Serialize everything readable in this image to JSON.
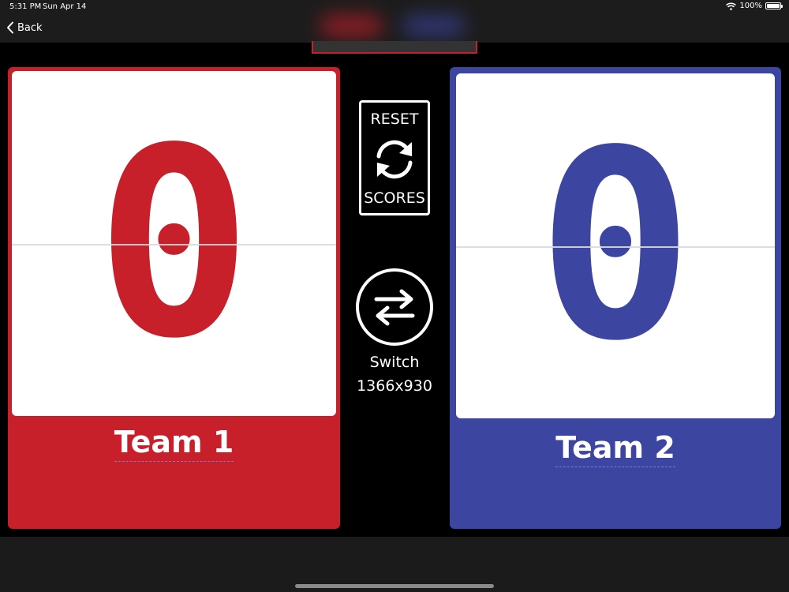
{
  "status_bar": {
    "time": "5:31 PM",
    "date": "Sun Apr 14",
    "battery": "100%"
  },
  "nav": {
    "back_label": "Back"
  },
  "center": {
    "reset_top": "RESET",
    "reset_bottom": "SCORES",
    "switch_label": "Switch",
    "size_label": "1366x930"
  },
  "teams": [
    {
      "name": "Team 1",
      "score": "0",
      "color": "#c8202a"
    },
    {
      "name": "Team 2",
      "score": "0",
      "color": "#3c45a0"
    }
  ],
  "colors": {
    "background": "#000000",
    "topbar": "#1c1c1c",
    "red": "#c8202a",
    "blue": "#3c45a0"
  },
  "icons": [
    "wifi-icon",
    "battery-icon",
    "chevron-left-icon",
    "refresh-icon",
    "swap-arrows-icon"
  ]
}
